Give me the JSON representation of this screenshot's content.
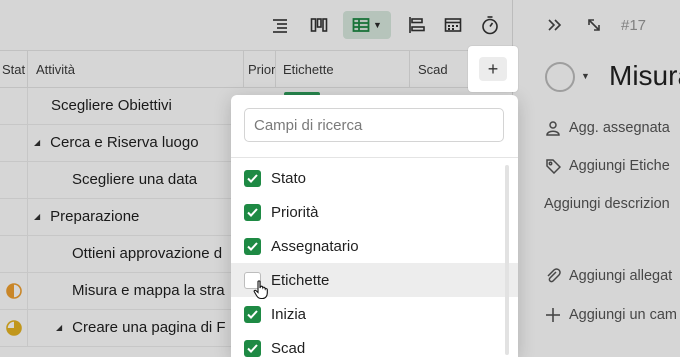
{
  "toolbar": {
    "views": [
      "list-view-icon",
      "board-view-icon",
      "table-view-icon",
      "gantt-view-icon",
      "calendar-view-icon",
      "timer-icon"
    ],
    "active_view": "table-view-icon"
  },
  "table": {
    "headers": {
      "status": "Stat",
      "task": "Attività",
      "priority": "Prior",
      "tags": "Etichette",
      "due": "Scad"
    },
    "add_column_label": "+",
    "rows": [
      {
        "task": "Scegliere Obiettivi",
        "indent": 1,
        "caret": false,
        "status": ""
      },
      {
        "task": "Cerca e Riserva luogo",
        "indent": 1,
        "caret": true,
        "status": ""
      },
      {
        "task": "Scegliere una data",
        "indent": 2,
        "caret": false,
        "status": ""
      },
      {
        "task": "Preparazione",
        "indent": 1,
        "caret": true,
        "status": ""
      },
      {
        "task": "Ottieni approvazione d",
        "indent": 2,
        "caret": false,
        "status": ""
      },
      {
        "task": "Misura e mappa la stra",
        "indent": 2,
        "caret": false,
        "status": "half-orange"
      },
      {
        "task": "Creare una pagina di F",
        "indent": 2,
        "caret": true,
        "status": "half-yellow"
      }
    ]
  },
  "dropdown": {
    "search_placeholder": "Campi di ricerca",
    "options": [
      {
        "label": "Stato",
        "checked": true
      },
      {
        "label": "Priorità",
        "checked": true
      },
      {
        "label": "Assegnatario",
        "checked": true
      },
      {
        "label": "Etichette",
        "checked": false
      },
      {
        "label": "Inizia",
        "checked": true
      },
      {
        "label": "Scad",
        "checked": true
      }
    ]
  },
  "panel": {
    "task_id": "#17",
    "title": "Misura",
    "assign": "Agg. assegnata",
    "tags": "Aggiungi Etiche",
    "description": "Aggiungi descrizion",
    "attachment": "Aggiungi allegat",
    "add_field": "Aggiungi un cam"
  },
  "colors": {
    "accent_green": "#1e8a44",
    "active_view_bg": "#d9eadf",
    "status_orange": "#f0a030",
    "status_yellow": "#e6b422"
  }
}
